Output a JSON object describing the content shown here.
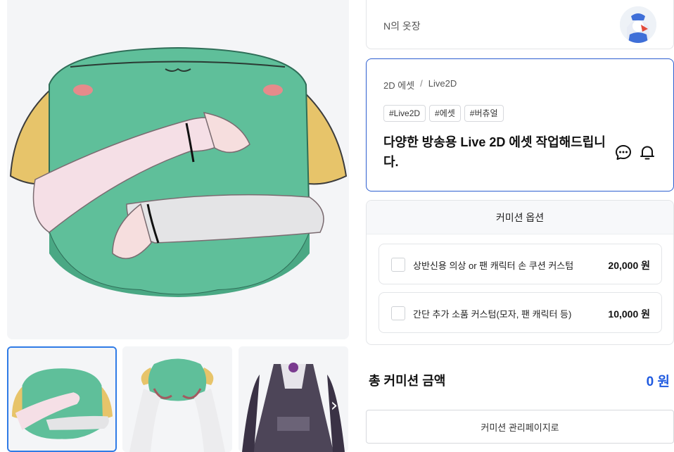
{
  "seller": {
    "name": "N의 옷장"
  },
  "product": {
    "breadcrumb": [
      "2D 에셋",
      "Live2D"
    ],
    "breadcrumb_separator": "/",
    "tags": [
      "#Live2D",
      "#에셋",
      "#버츄얼"
    ],
    "title": "다양한 방송용 Live 2D 에셋 작업해드립니다.",
    "icons": [
      "chat-icon",
      "bell-icon"
    ]
  },
  "options": {
    "header": "커미션 옵션",
    "items": [
      {
        "label": "상반신용 의상 or 팬 캐릭터 손 쿠션 커스텀",
        "price": "20,000 원",
        "checked": false
      },
      {
        "label": "간단 추가 소품 커스텀(모자, 팬 캐릭터 등)",
        "price": "10,000 원",
        "checked": false
      }
    ]
  },
  "total": {
    "label": "총 커미션 금액",
    "value": "0 원"
  },
  "manage_button_label": "커미션 관리페이지로",
  "gallery": {
    "selected_index": 0,
    "next_icon": "chevron-right-icon"
  },
  "colors": {
    "accent": "#1f5ae0",
    "selected_border": "#2d5fd0",
    "cushion_green": "#5fbf9a",
    "ear_yellow": "#e7c46a"
  }
}
